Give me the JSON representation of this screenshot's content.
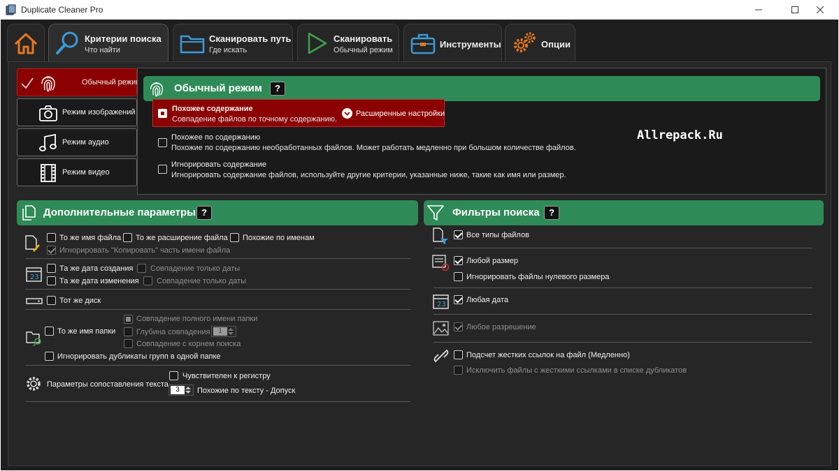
{
  "window": {
    "title": "Duplicate Cleaner Pro"
  },
  "tabs": [
    {
      "icon": "home-icon",
      "label": "",
      "sub": ""
    },
    {
      "icon": "search-icon",
      "label": "Критерии поиска",
      "sub": "Что найти"
    },
    {
      "icon": "folder-icon",
      "label": "Сканировать путь",
      "sub": "Где искать"
    },
    {
      "icon": "play-icon",
      "label": "Сканировать",
      "sub": "Обычный режим"
    },
    {
      "icon": "toolbox-icon",
      "label": "Инструменты",
      "sub": ""
    },
    {
      "icon": "gears-icon",
      "label": "Опции",
      "sub": ""
    }
  ],
  "modes": [
    {
      "label": "Обычный режим",
      "icon": "fingerprint-icon",
      "active": true
    },
    {
      "label": "Режим изображений",
      "icon": "camera-icon",
      "active": false
    },
    {
      "label": "Режим аудио",
      "icon": "music-note-icon",
      "active": false
    },
    {
      "label": "Режим видео",
      "icon": "film-icon",
      "active": false
    }
  ],
  "mode_panel": {
    "title": "Обычный режим",
    "help": "?",
    "options": [
      {
        "title": "Похожее содержание",
        "sub": "Совпадение файлов по точному содержанию.",
        "selected": true
      },
      {
        "title": "Похожее по содержанию",
        "sub": "Похожие по содержанию необработанных файлов. Может работать медленно при большом количестве файлов.",
        "selected": false
      },
      {
        "title": "Игнорировать содержание",
        "sub": "Игнорировать содержание файлов, используйте другие критерии, указанные ниже, такие как имя или размер.",
        "selected": false
      }
    ],
    "advanced_label": "Расширенные настройки",
    "watermark": "Allrepack.Ru"
  },
  "additional": {
    "title": "Дополнительные параметры",
    "help": "?",
    "same_name": "То же имя файла",
    "same_ext": "То же расширение файла",
    "similar_names": "Похожие по именам",
    "ignore_copy": "Игнорировать \"Копировать\" часть имени файла",
    "same_created": "Та же дата создания",
    "date_only_1": "Совпадение только даты",
    "same_modified": "Та же дата изменения",
    "date_only_2": "Совпадение только даты",
    "same_disk": "Тот же диск",
    "same_folder": "То же имя папки",
    "full_folder": "Совпадение полного имени папки",
    "match_depth": "Глубина совпадения",
    "match_depth_value": "1",
    "root_match": "Совпадение с корнем поиска",
    "ignore_group_dupes": "Игнорировать дубликаты групп в одной папке",
    "text_params": "Параметры сопоставления текста",
    "case_sensitive": "Чувствителен к регистру",
    "tolerance_value": "3",
    "tolerance_label": "Похожие по тексту - Допуск"
  },
  "filters": {
    "title": "Фильтры поиска",
    "help": "?",
    "all_types": "Все типы файлов",
    "any_size": "Любой размер",
    "ignore_zero": "Игнорировать файлы нулевого размера",
    "any_date": "Любая дата",
    "any_resolution": "Любое разрешение",
    "hardlinks": "Подсчет жестких ссылок на файл (Медленно)",
    "exclude_hardlinks": "Исключить файлы с жесткими ссылками в списке дубликатов"
  },
  "colors": {
    "accent_green": "#2e8b57",
    "active_red": "#8b0000",
    "icon_orange": "#e8761e",
    "icon_blue": "#3b9ad9"
  }
}
